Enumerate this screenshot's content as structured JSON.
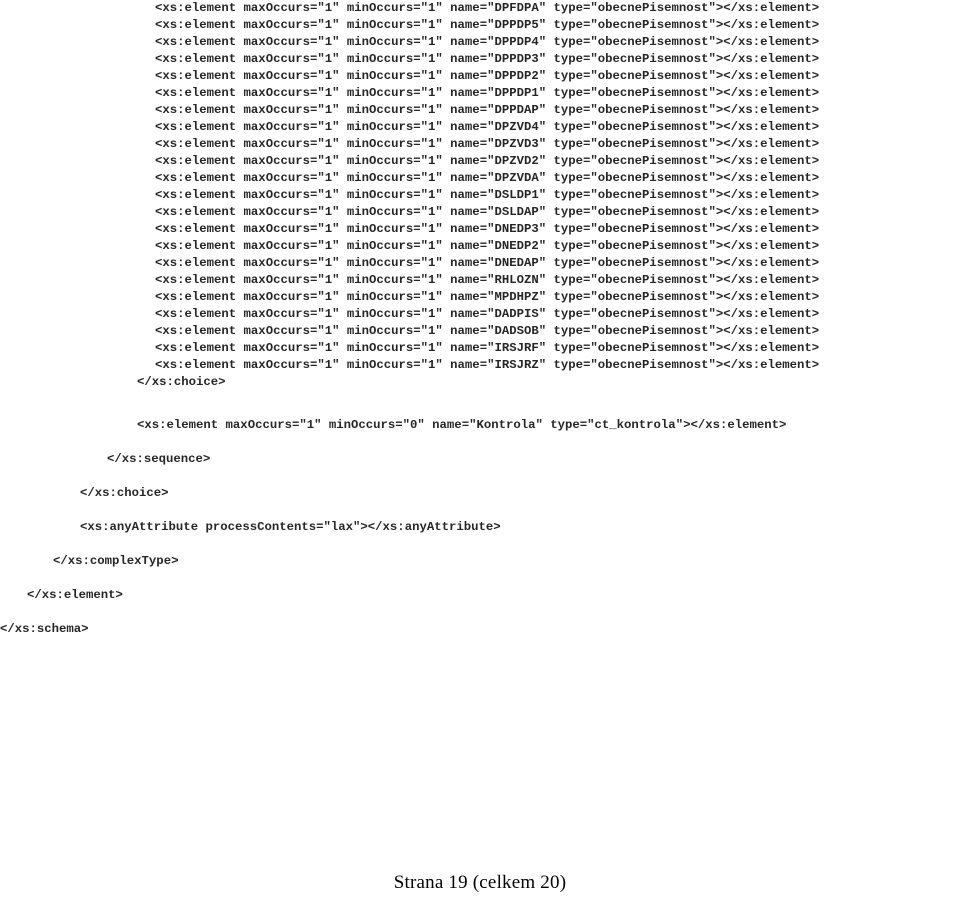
{
  "document": {
    "type": "xsd-schema-listing",
    "language": "xml",
    "text_color": "#262626",
    "background_color": "#ffffff"
  },
  "code": {
    "element_tag_open": "<xs:element",
    "attr_maxoccurs": "maxOccurs=\"1\"",
    "attr_minoccurs_one": "minOccurs=\"1\"",
    "attr_minoccurs_zero": "minOccurs=\"0\"",
    "type_value": "obecnePisemnost",
    "element_close": "></xs:element>",
    "elements": [
      {
        "line": "<xs:element maxOccurs=\"1\" minOccurs=\"1\" name=\"DPFDPA\" type=\"obecnePisemnost\"></xs:element>",
        "name": "DPFDPA",
        "maxOccurs": "1",
        "minOccurs": "1",
        "type": "obecnePisemnost"
      },
      {
        "line": "<xs:element maxOccurs=\"1\" minOccurs=\"1\" name=\"DPPDP5\" type=\"obecnePisemnost\"></xs:element>",
        "name": "DPPDP5",
        "maxOccurs": "1",
        "minOccurs": "1",
        "type": "obecnePisemnost"
      },
      {
        "line": "<xs:element maxOccurs=\"1\" minOccurs=\"1\" name=\"DPPDP4\" type=\"obecnePisemnost\"></xs:element>",
        "name": "DPPDP4",
        "maxOccurs": "1",
        "minOccurs": "1",
        "type": "obecnePisemnost"
      },
      {
        "line": "<xs:element maxOccurs=\"1\" minOccurs=\"1\" name=\"DPPDP3\" type=\"obecnePisemnost\"></xs:element>",
        "name": "DPPDP3",
        "maxOccurs": "1",
        "minOccurs": "1",
        "type": "obecnePisemnost"
      },
      {
        "line": "<xs:element maxOccurs=\"1\" minOccurs=\"1\" name=\"DPPDP2\" type=\"obecnePisemnost\"></xs:element>",
        "name": "DPPDP2",
        "maxOccurs": "1",
        "minOccurs": "1",
        "type": "obecnePisemnost"
      },
      {
        "line": "<xs:element maxOccurs=\"1\" minOccurs=\"1\" name=\"DPPDP1\" type=\"obecnePisemnost\"></xs:element>",
        "name": "DPPDP1",
        "maxOccurs": "1",
        "minOccurs": "1",
        "type": "obecnePisemnost"
      },
      {
        "line": "<xs:element maxOccurs=\"1\" minOccurs=\"1\" name=\"DPPDAP\" type=\"obecnePisemnost\"></xs:element>",
        "name": "DPPDAP",
        "maxOccurs": "1",
        "minOccurs": "1",
        "type": "obecnePisemnost"
      },
      {
        "line": "<xs:element maxOccurs=\"1\" minOccurs=\"1\" name=\"DPZVD4\" type=\"obecnePisemnost\"></xs:element>",
        "name": "DPZVD4",
        "maxOccurs": "1",
        "minOccurs": "1",
        "type": "obecnePisemnost"
      },
      {
        "line": "<xs:element maxOccurs=\"1\" minOccurs=\"1\" name=\"DPZVD3\" type=\"obecnePisemnost\"></xs:element>",
        "name": "DPZVD3",
        "maxOccurs": "1",
        "minOccurs": "1",
        "type": "obecnePisemnost"
      },
      {
        "line": "<xs:element maxOccurs=\"1\" minOccurs=\"1\" name=\"DPZVD2\" type=\"obecnePisemnost\"></xs:element>",
        "name": "DPZVD2",
        "maxOccurs": "1",
        "minOccurs": "1",
        "type": "obecnePisemnost"
      },
      {
        "line": "<xs:element maxOccurs=\"1\" minOccurs=\"1\" name=\"DPZVDA\" type=\"obecnePisemnost\"></xs:element>",
        "name": "DPZVDA",
        "maxOccurs": "1",
        "minOccurs": "1",
        "type": "obecnePisemnost"
      },
      {
        "line": "<xs:element maxOccurs=\"1\" minOccurs=\"1\" name=\"DSLDP1\" type=\"obecnePisemnost\"></xs:element>",
        "name": "DSLDP1",
        "maxOccurs": "1",
        "minOccurs": "1",
        "type": "obecnePisemnost"
      },
      {
        "line": "<xs:element maxOccurs=\"1\" minOccurs=\"1\" name=\"DSLDAP\" type=\"obecnePisemnost\"></xs:element>",
        "name": "DSLDAP",
        "maxOccurs": "1",
        "minOccurs": "1",
        "type": "obecnePisemnost"
      },
      {
        "line": "<xs:element maxOccurs=\"1\" minOccurs=\"1\" name=\"DNEDP3\" type=\"obecnePisemnost\"></xs:element>",
        "name": "DNEDP3",
        "maxOccurs": "1",
        "minOccurs": "1",
        "type": "obecnePisemnost"
      },
      {
        "line": "<xs:element maxOccurs=\"1\" minOccurs=\"1\" name=\"DNEDP2\" type=\"obecnePisemnost\"></xs:element>",
        "name": "DNEDP2",
        "maxOccurs": "1",
        "minOccurs": "1",
        "type": "obecnePisemnost"
      },
      {
        "line": "<xs:element maxOccurs=\"1\" minOccurs=\"1\" name=\"DNEDAP\" type=\"obecnePisemnost\"></xs:element>",
        "name": "DNEDAP",
        "maxOccurs": "1",
        "minOccurs": "1",
        "type": "obecnePisemnost"
      },
      {
        "line": "<xs:element maxOccurs=\"1\" minOccurs=\"1\" name=\"RHLOZN\" type=\"obecnePisemnost\"></xs:element>",
        "name": "RHLOZN",
        "maxOccurs": "1",
        "minOccurs": "1",
        "type": "obecnePisemnost"
      },
      {
        "line": "<xs:element maxOccurs=\"1\" minOccurs=\"1\" name=\"MPDHPZ\" type=\"obecnePisemnost\"></xs:element>",
        "name": "MPDHPZ",
        "maxOccurs": "1",
        "minOccurs": "1",
        "type": "obecnePisemnost"
      },
      {
        "line": "<xs:element maxOccurs=\"1\" minOccurs=\"1\" name=\"DADPIS\" type=\"obecnePisemnost\"></xs:element>",
        "name": "DADPIS",
        "maxOccurs": "1",
        "minOccurs": "1",
        "type": "obecnePisemnost"
      },
      {
        "line": "<xs:element maxOccurs=\"1\" minOccurs=\"1\" name=\"DADSOB\" type=\"obecnePisemnost\"></xs:element>",
        "name": "DADSOB",
        "maxOccurs": "1",
        "minOccurs": "1",
        "type": "obecnePisemnost"
      },
      {
        "line": "<xs:element maxOccurs=\"1\" minOccurs=\"1\" name=\"IRSJRF\" type=\"obecnePisemnost\"></xs:element>",
        "name": "IRSJRF",
        "maxOccurs": "1",
        "minOccurs": "1",
        "type": "obecnePisemnost"
      },
      {
        "line": "<xs:element maxOccurs=\"1\" minOccurs=\"1\" name=\"IRSJRZ\" type=\"obecnePisemnost\"></xs:element>",
        "name": "IRSJRZ",
        "maxOccurs": "1",
        "minOccurs": "1",
        "type": "obecnePisemnost"
      }
    ],
    "closing_choice_inner": "</xs:choice>",
    "kontrola_element": "<xs:element maxOccurs=\"1\" minOccurs=\"0\" name=\"Kontrola\" type=\"ct_kontrola\"></xs:element>",
    "kontrola_name": "Kontrola",
    "kontrola_type": "ct_kontrola",
    "closing_sequence": "</xs:sequence>",
    "closing_choice_outer": "</xs:choice>",
    "any_attribute": "<xs:anyAttribute processContents=\"lax\"></xs:anyAttribute>",
    "any_attribute_processcontents": "lax",
    "closing_complextype": "</xs:complexType>",
    "closing_element": "</xs:element>",
    "closing_schema": "</xs:schema>"
  },
  "footer": {
    "page_label": "Strana 19 (celkem 20)",
    "current_page": 19,
    "total_pages": 20
  }
}
